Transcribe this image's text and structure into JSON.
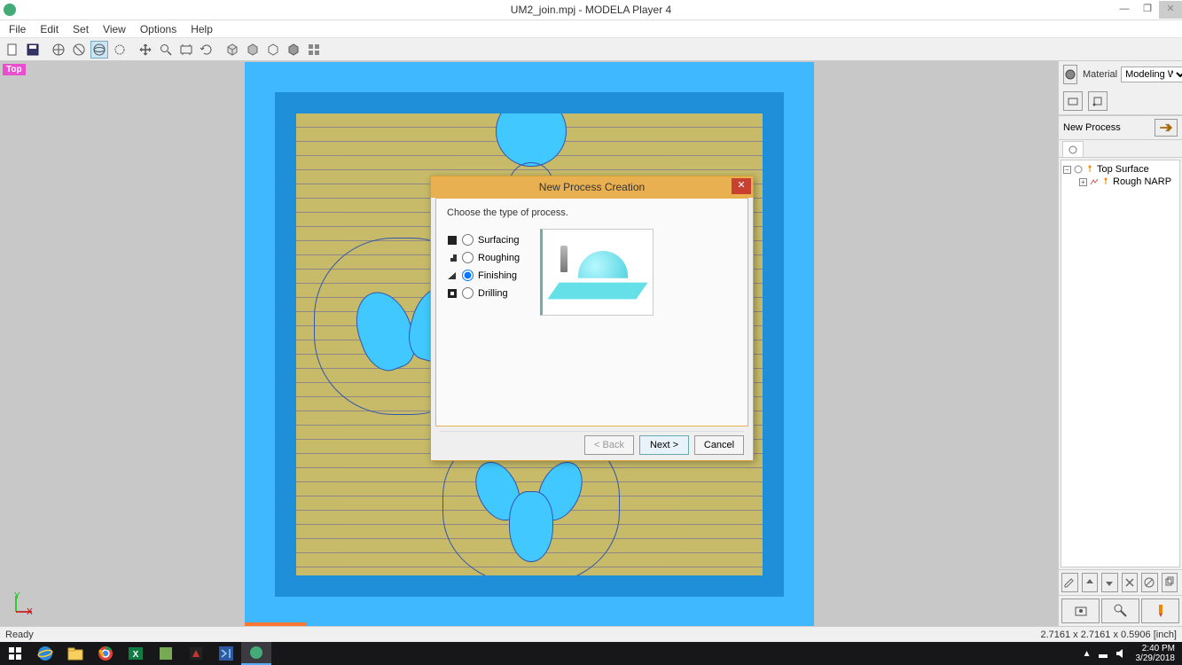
{
  "window": {
    "title": "UM2_join.mpj - MODELA Player 4",
    "minimize": "—",
    "restore": "❐",
    "close": "✕"
  },
  "menu": [
    "File",
    "Edit",
    "Set",
    "View",
    "Options",
    "Help"
  ],
  "viewport": {
    "badge": "Top",
    "axis_y": "Y",
    "axis_x": "X"
  },
  "sidepanel": {
    "material_label": "Material",
    "material_value": "Modeling Wax",
    "newprocess_label": "New Process",
    "tree": {
      "root": "Top Surface",
      "child": "Rough NARP"
    }
  },
  "dialog": {
    "title": "New Process Creation",
    "prompt": "Choose the type of process.",
    "options": {
      "surfacing": "Surfacing",
      "roughing": "Roughing",
      "finishing": "Finishing",
      "drilling": "Drilling"
    },
    "selected": "finishing",
    "buttons": {
      "back": "< Back",
      "next": "Next >",
      "cancel": "Cancel"
    }
  },
  "statusbar": {
    "left": "Ready",
    "right": "2.7161 x 2.7161 x 0.5906 [inch]"
  },
  "taskbar": {
    "time": "2:40 PM",
    "date": "3/29/2018",
    "tray_up": "▲"
  }
}
